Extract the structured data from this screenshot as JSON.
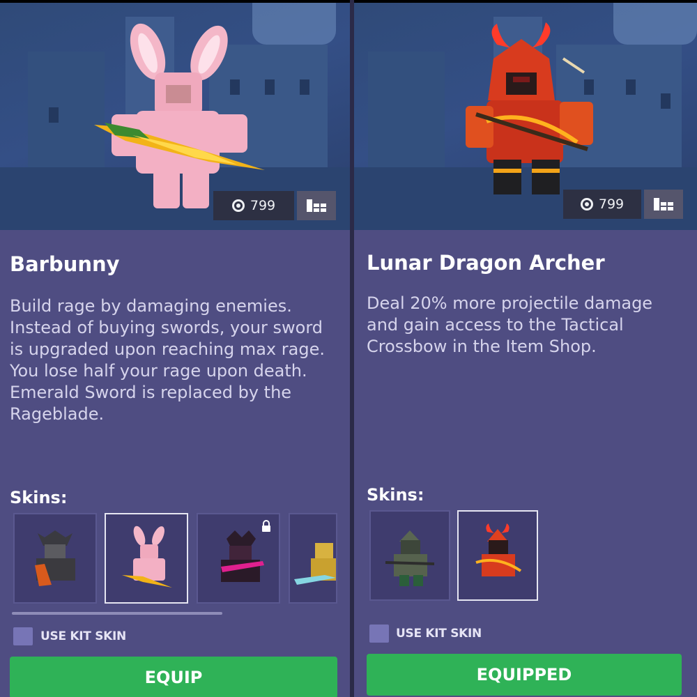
{
  "kits": [
    {
      "name": "Barbunny",
      "description": "Build rage by damaging enemies. Instead of buying swords, your sword is upgraded upon reaching max rage. You lose half your rage upon death. Emerald Sword is replaced by the Rageblade.",
      "price": "799",
      "skins_label": "Skins:",
      "skins": [
        {
          "name": "dark-warrior-skin",
          "selected": false,
          "locked": false
        },
        {
          "name": "pink-bunny-skin",
          "selected": true,
          "locked": false
        },
        {
          "name": "magenta-demon-skin",
          "selected": false,
          "locked": true
        },
        {
          "name": "gold-skin",
          "selected": false,
          "locked": false
        }
      ],
      "use_kit_skin_label": "USE KIT SKIN",
      "use_kit_skin_checked": false,
      "button_label": "EQUIP"
    },
    {
      "name": "Lunar Dragon Archer",
      "description": "Deal 20% more projectile damage and gain access to the Tactical Crossbow in the Item Shop.",
      "price": "799",
      "skins_label": "Skins:",
      "skins": [
        {
          "name": "green-archer-skin",
          "selected": false,
          "locked": false
        },
        {
          "name": "red-dragon-archer-skin",
          "selected": true,
          "locked": false
        }
      ],
      "use_kit_skin_label": "USE KIT SKIN",
      "use_kit_skin_checked": false,
      "button_label": "EQUIPPED"
    }
  ],
  "colors": {
    "panel": "#4f4d82",
    "button_green": "#2fb257",
    "checkbox": "#7775b6"
  }
}
